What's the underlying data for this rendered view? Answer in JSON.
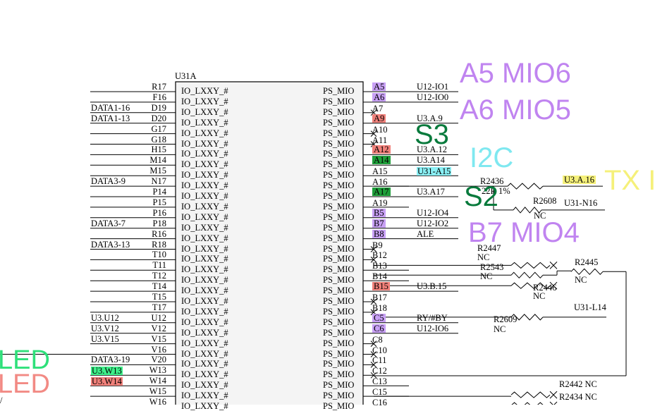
{
  "part_ref": "U31A",
  "left_io_label": "IO_LXXY_#",
  "right_io_label": "PS_MIO",
  "left_pins": [
    {
      "pin": "R17",
      "net": ""
    },
    {
      "pin": "F16",
      "net": ""
    },
    {
      "pin": "D19",
      "net": "DATA1-16"
    },
    {
      "pin": "D20",
      "net": "DATA1-13"
    },
    {
      "pin": "G17",
      "net": ""
    },
    {
      "pin": "G18",
      "net": ""
    },
    {
      "pin": "H15",
      "net": ""
    },
    {
      "pin": "M14",
      "net": ""
    },
    {
      "pin": "M15",
      "net": ""
    },
    {
      "pin": "N17",
      "net": "DATA3-9"
    },
    {
      "pin": "P14",
      "net": ""
    },
    {
      "pin": "P15",
      "net": ""
    },
    {
      "pin": "P16",
      "net": ""
    },
    {
      "pin": "P18",
      "net": "DATA3-7"
    },
    {
      "pin": "R16",
      "net": ""
    },
    {
      "pin": "R18",
      "net": "DATA3-13"
    },
    {
      "pin": "T10",
      "net": ""
    },
    {
      "pin": "T11",
      "net": ""
    },
    {
      "pin": "T12",
      "net": ""
    },
    {
      "pin": "T14",
      "net": ""
    },
    {
      "pin": "T15",
      "net": ""
    },
    {
      "pin": "T17",
      "net": ""
    },
    {
      "pin": "U12",
      "net": "U3.U12"
    },
    {
      "pin": "V12",
      "net": "U3.V12"
    },
    {
      "pin": "V15",
      "net": "U3.V15"
    },
    {
      "pin": "V16",
      "net": ""
    },
    {
      "pin": "V20",
      "net": "DATA3-19"
    },
    {
      "pin": "W13",
      "net": "U3.W13"
    },
    {
      "pin": "W14",
      "net": "U3.W14"
    },
    {
      "pin": "W15",
      "net": ""
    },
    {
      "pin": "W16",
      "net": ""
    }
  ],
  "right_pins": [
    {
      "pin": "A5",
      "net": "U12-IO1"
    },
    {
      "pin": "A6",
      "net": "U12-IO0"
    },
    {
      "pin": "A7",
      "net": ""
    },
    {
      "pin": "A9",
      "net": "U3.A.9"
    },
    {
      "pin": "A10",
      "net": ""
    },
    {
      "pin": "A11",
      "net": ""
    },
    {
      "pin": "A12",
      "net": "U3.A.12"
    },
    {
      "pin": "A14",
      "net": "U3.A14"
    },
    {
      "pin": "A15",
      "net": "U31-A15"
    },
    {
      "pin": "A16",
      "net": ""
    },
    {
      "pin": "A17",
      "net": "U3.A17"
    },
    {
      "pin": "A19",
      "net": ""
    },
    {
      "pin": "B5",
      "net": "U12-IO4"
    },
    {
      "pin": "B7",
      "net": "U12-IO2"
    },
    {
      "pin": "B8",
      "net": "ALE"
    },
    {
      "pin": "B9",
      "net": ""
    },
    {
      "pin": "B12",
      "net": ""
    },
    {
      "pin": "B13",
      "net": ""
    },
    {
      "pin": "B14",
      "net": ""
    },
    {
      "pin": "B15",
      "net": "U3.B.15"
    },
    {
      "pin": "B17",
      "net": ""
    },
    {
      "pin": "B18",
      "net": ""
    },
    {
      "pin": "C5",
      "net": "RY/#BY"
    },
    {
      "pin": "C6",
      "net": "U12-IO6"
    },
    {
      "pin": "C8",
      "net": ""
    },
    {
      "pin": "C10",
      "net": ""
    },
    {
      "pin": "C11",
      "net": ""
    },
    {
      "pin": "C12",
      "net": ""
    },
    {
      "pin": "C13",
      "net": ""
    },
    {
      "pin": "C15",
      "net": ""
    },
    {
      "pin": "C16",
      "net": ""
    }
  ],
  "components": {
    "r2436": {
      "ref": "R2436",
      "value": "22R 1%",
      "net": "U3.A.16"
    },
    "r2608": {
      "ref": "R2608",
      "value": "NC",
      "net": "U31-N16"
    },
    "r2447": {
      "ref": "R2447",
      "value": "NC"
    },
    "r2543": {
      "ref": "R2543",
      "value": "NC"
    },
    "r2445": {
      "ref": "R2445",
      "value": "NC"
    },
    "r2446": {
      "ref": "R2446",
      "value": "NC"
    },
    "u31l14": {
      "net": "U31-L14"
    },
    "r2609": {
      "ref": "R2609",
      "value": "NC"
    },
    "r2442": {
      "label": "R2442 NC"
    },
    "r2434": {
      "label": "R2434 NC"
    }
  },
  "overlays": {
    "a5": "A5 MIO6",
    "a6": "A6 MIO5",
    "s3": "S3",
    "i2c": "I2C",
    "tx": "TX I",
    "s2": "S2",
    "b7": "B7 MIO4",
    "led1": "LED",
    "led2": "LED",
    "cut_left": "/"
  },
  "colors": {
    "purple": "#c084f0",
    "dark_green": "#087a3c",
    "cyan": "#7fe8f0",
    "yellow": "#f5f07a",
    "bright_green": "#2ee07a",
    "salmon": "#f28a84",
    "hl_purple": "#c8a0f5",
    "hl_red": "#f0807a",
    "hl_green": "#1f9e3a",
    "hl_cyan": "#8af0f5",
    "hl_yellow": "#f5f07a",
    "hl_bright_green": "#3ef08a"
  }
}
